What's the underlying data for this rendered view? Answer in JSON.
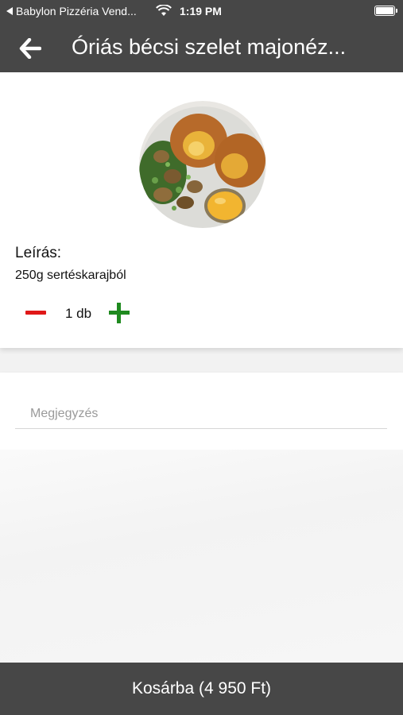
{
  "status_bar": {
    "back_app": "Babylon Pizzéria Vend...",
    "time": "1:19 PM",
    "wifi_icon": "wifi-icon",
    "battery_icon": "battery-icon"
  },
  "nav": {
    "back_icon": "arrow-left-icon",
    "title": "Óriás bécsi szelet majonéz..."
  },
  "product": {
    "image_icon": "food-photo",
    "description_label": "Leírás:",
    "description_text": "250g sertéskarajból",
    "quantity_text": "1 db"
  },
  "note": {
    "placeholder": "Megjegyzés",
    "value": ""
  },
  "cart": {
    "button_label": "Kosárba (4 950 Ft)"
  },
  "colors": {
    "header_bg": "#474747",
    "minus": "#e01818",
    "plus": "#1f8a1f"
  }
}
